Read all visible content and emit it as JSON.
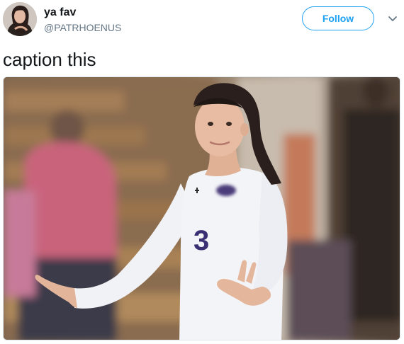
{
  "tweet": {
    "display_name": "ya fav",
    "handle": "@PATRHOENUS",
    "follow_label": "Follow",
    "text": "caption this",
    "jersey_number": "3"
  },
  "icons": {
    "caret": "chevron-down-icon",
    "avatar": "profile-avatar-photo",
    "media": "photo-volleyball-player"
  },
  "colors": {
    "accent": "#1da1f2",
    "text_primary": "#14171a",
    "text_secondary": "#657786",
    "caret": "#657786",
    "border": "#e1e8ed"
  }
}
